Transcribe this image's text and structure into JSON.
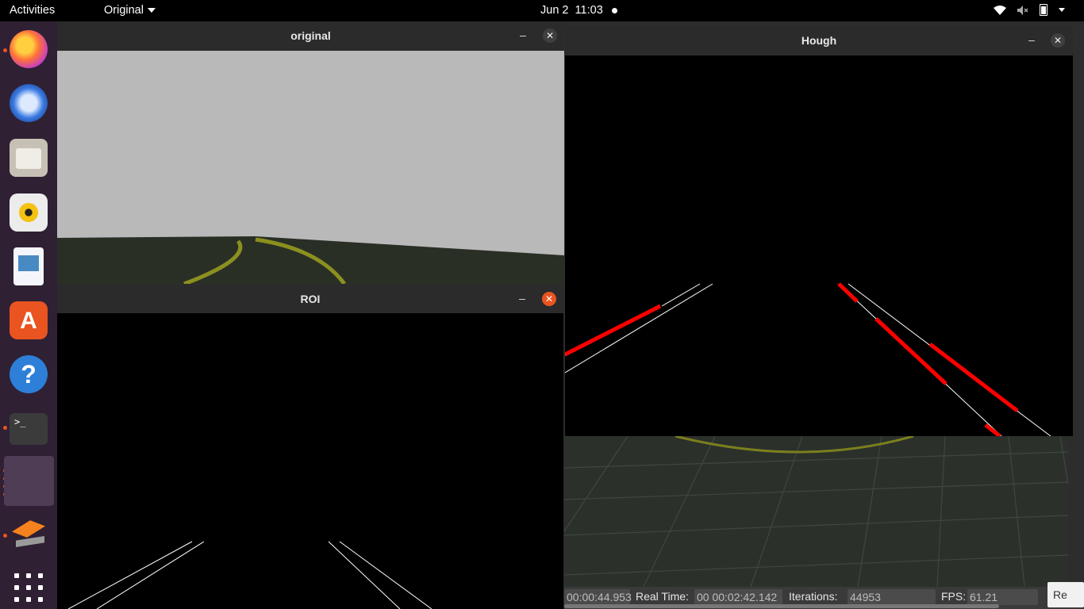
{
  "topbar": {
    "activities": "Activities",
    "app_menu": "Original",
    "date": "Jun 2",
    "time": "11:03",
    "indicators": [
      "wifi-icon",
      "speaker-muted-icon",
      "battery-icon",
      "menu-caret-icon"
    ]
  },
  "dock": {
    "items": [
      {
        "name": "firefox-icon",
        "running": true
      },
      {
        "name": "thunderbird-icon",
        "running": false
      },
      {
        "name": "files-icon",
        "running": false
      },
      {
        "name": "rhythmbox-icon",
        "running": false
      },
      {
        "name": "libreoffice-writer-icon",
        "running": false
      },
      {
        "name": "ubuntu-software-icon",
        "running": false,
        "glyph": "A"
      },
      {
        "name": "help-icon",
        "running": false,
        "glyph": "?"
      },
      {
        "name": "terminal-icon",
        "running": true,
        "glyph": ">_"
      },
      {
        "name": "opencv-windows-app",
        "running": true
      },
      {
        "name": "gazebo-icon",
        "running": true
      },
      {
        "name": "show-apps-icon",
        "running": false
      }
    ]
  },
  "windows": {
    "original": {
      "title": "original"
    },
    "roi": {
      "title": "ROI"
    },
    "hough": {
      "title": "Hough"
    }
  },
  "gazebo": {
    "sim_time_value": "00:00:44.953",
    "real_time_label": "Real Time:",
    "real_time_value": "00 00:02:42.142",
    "iterations_label": "Iterations:",
    "iterations_value": "44953",
    "fps_label": "FPS:",
    "fps_value": "61.21",
    "reset_label": "Re"
  },
  "colors": {
    "accent": "#e95420",
    "dock_bg": "#2f2034",
    "lane_yellow": "#8c8f1f",
    "hough_red": "#ff0000"
  }
}
